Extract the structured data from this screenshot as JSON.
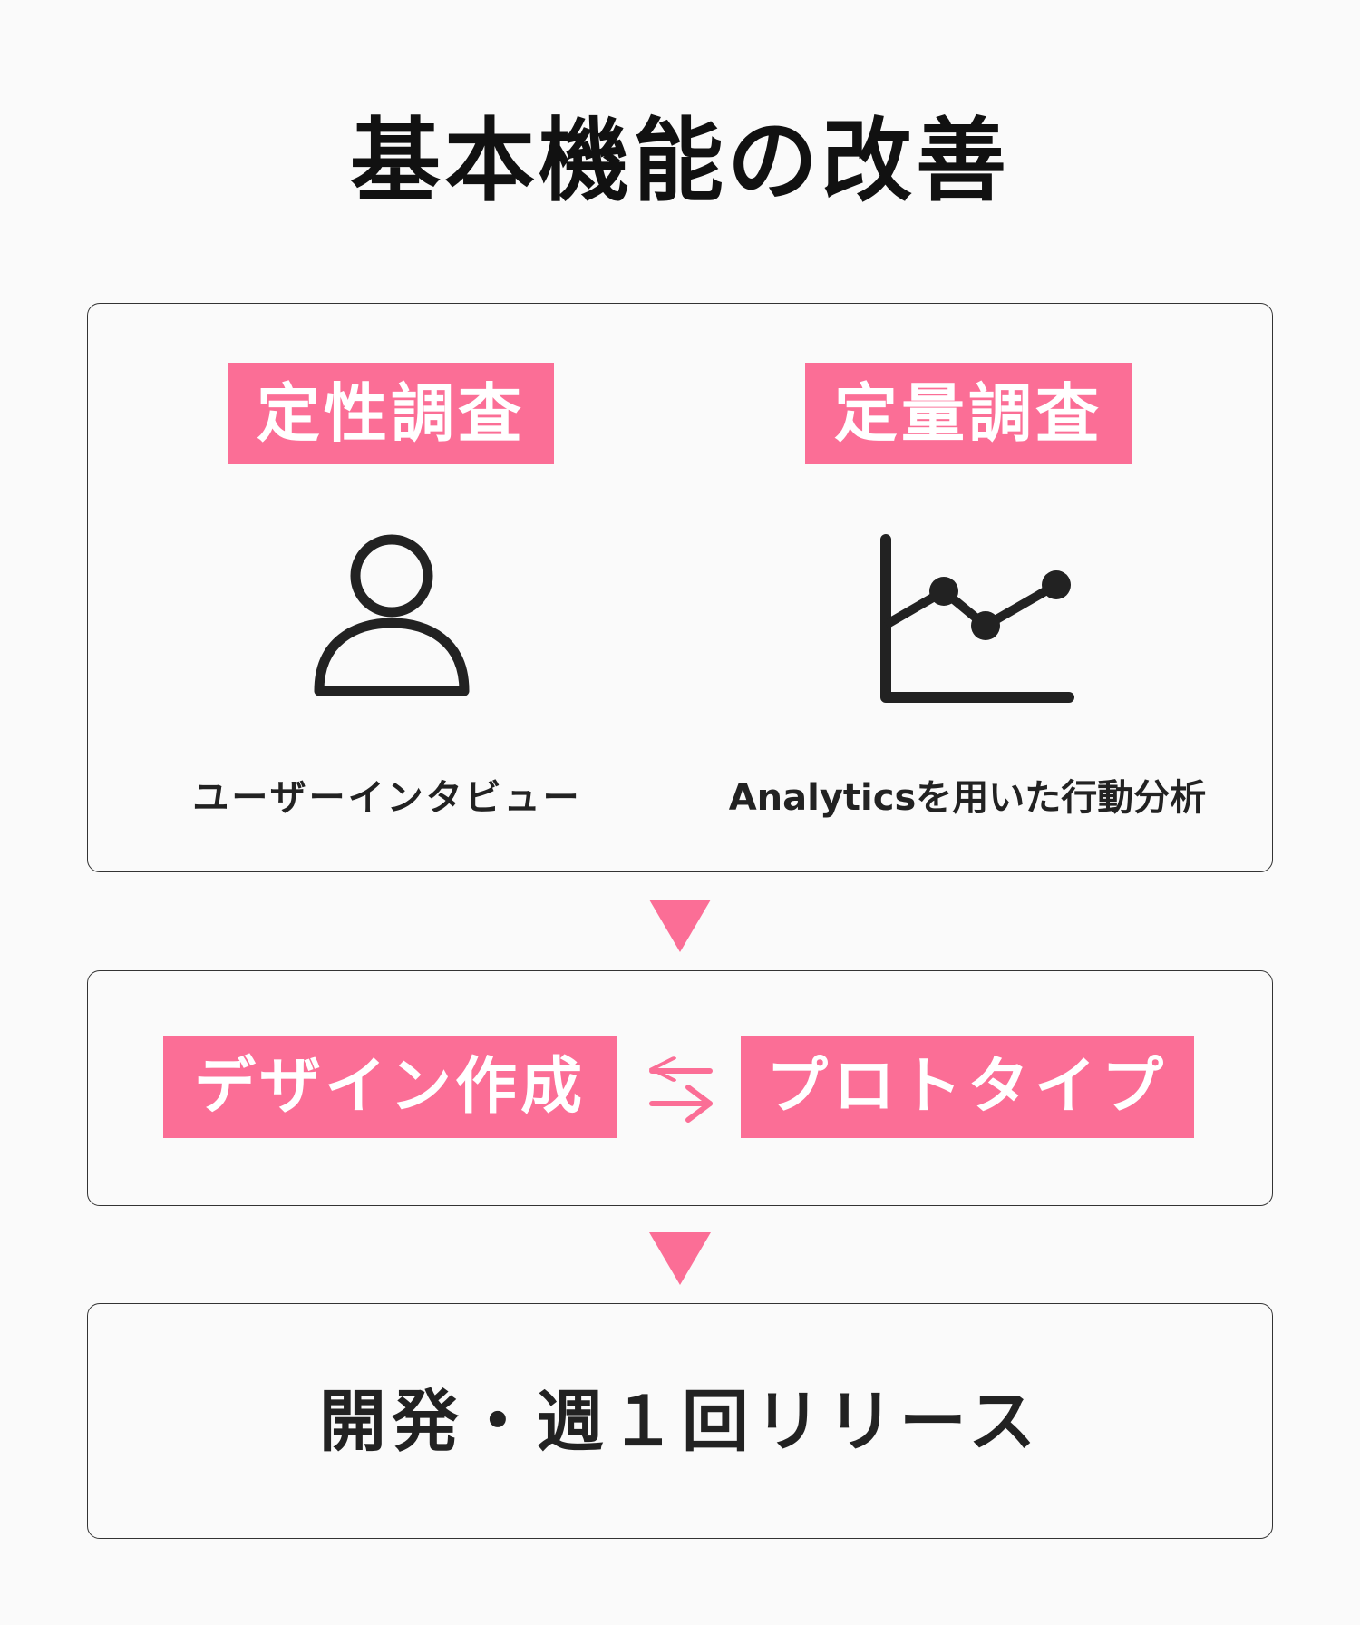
{
  "title": "基本機能の改善",
  "research": {
    "qualitative": {
      "label": "定性調査",
      "icon": "person-icon",
      "caption": "ユーザーインタビュー"
    },
    "quantitative": {
      "label": "定量調査",
      "icon": "line-chart-icon",
      "caption": "Analyticsを用いた行動分析"
    }
  },
  "iteration": {
    "design_label": "デザイン作成",
    "swap_icon": "bidirectional-arrows-icon",
    "prototype_label": "プロトタイプ"
  },
  "release": {
    "text": "開発・週１回リリース"
  },
  "colors": {
    "accent": "#fb6e96",
    "text": "#222222",
    "background": "#fafafa",
    "border": "#333333"
  }
}
